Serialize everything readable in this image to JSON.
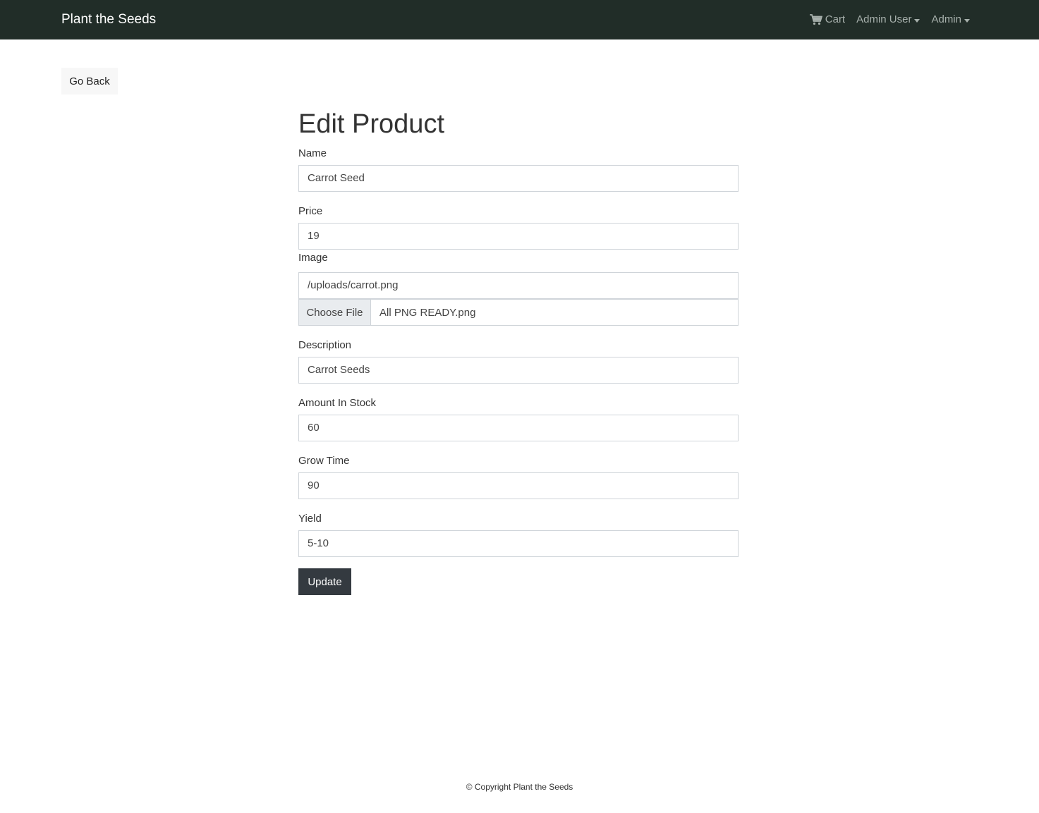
{
  "navbar": {
    "brand": "Plant the Seeds",
    "cart_label": "Cart",
    "cart_icon": "cart-icon",
    "user_menu_label": "Admin User",
    "admin_menu_label": "Admin"
  },
  "go_back_label": "Go Back",
  "form": {
    "title": "Edit Product",
    "name": {
      "label": "Name",
      "value": "Carrot Seed"
    },
    "price": {
      "label": "Price",
      "value": "19"
    },
    "image": {
      "label": "Image",
      "value": "/uploads/carrot.png",
      "file_button": "Choose File",
      "file_name": "All PNG READY.png"
    },
    "description": {
      "label": "Description",
      "value": "Carrot Seeds"
    },
    "stock": {
      "label": "Amount In Stock",
      "value": "60"
    },
    "grow_time": {
      "label": "Grow Time",
      "value": "90"
    },
    "yield": {
      "label": "Yield",
      "value": "5-10"
    },
    "submit_label": "Update"
  },
  "footer": {
    "text": "© Copyright Plant the Seeds"
  },
  "colors": {
    "navbar_bg": "#212d28",
    "button_dark": "#343a40"
  }
}
